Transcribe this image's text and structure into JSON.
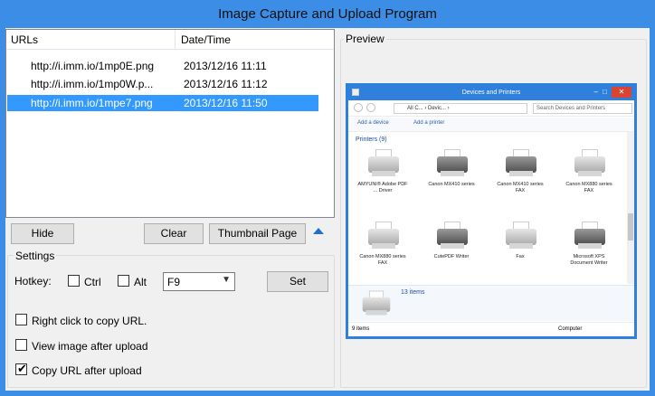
{
  "window": {
    "title": "Image Capture and Upload Program"
  },
  "url_list": {
    "columns": [
      "URLs",
      "Date/Time"
    ],
    "rows": [
      {
        "url": "http://i.imm.io/1mp0E.png",
        "date": "2013/12/16 11:11",
        "selected": false
      },
      {
        "url": "http://i.imm.io/1mp0W.p...",
        "date": "2013/12/16 11:12",
        "selected": false
      },
      {
        "url": "http://i.imm.io/1mpe7.png",
        "date": "2013/12/16 11:50",
        "selected": true
      }
    ]
  },
  "buttons": {
    "hide": "Hide",
    "clear": "Clear",
    "thumbnail_page": "Thumbnail Page",
    "set": "Set"
  },
  "settings": {
    "label": "Settings",
    "hotkey_label": "Hotkey:",
    "ctrl": {
      "label": "Ctrl",
      "checked": false
    },
    "alt": {
      "label": "Alt",
      "checked": false
    },
    "key": "F9",
    "options": [
      {
        "label": "Right click to copy URL.",
        "checked": false
      },
      {
        "label": "View image after upload",
        "checked": false
      },
      {
        "label": "Copy URL after upload",
        "checked": true
      }
    ]
  },
  "preview": {
    "label": "Preview",
    "image": {
      "title": "Devices and Printers",
      "address": "All C... › Devic... ›",
      "search": "Search Devices and Printers",
      "toolbar_add_device": "Add a device",
      "toolbar_add_printer": "Add a printer",
      "group": "Printers (9)",
      "items": [
        {
          "caption": "AMYUNI® Adobe PDF ... Driver",
          "dark": false
        },
        {
          "caption": "Canon MX410 series",
          "dark": true
        },
        {
          "caption": "Canon MX410 series FAX",
          "dark": true
        },
        {
          "caption": "Canon MX880 series FAX",
          "dark": false
        },
        {
          "caption": "Canon MX880 series FAX",
          "dark": false
        },
        {
          "caption": "CutePDF Writer",
          "dark": true
        },
        {
          "caption": "Fax",
          "dark": false
        },
        {
          "caption": "Microsoft XPS Document Writer",
          "dark": true
        }
      ],
      "count": "13 items",
      "status_left": "9 items",
      "status_right": "Computer"
    }
  },
  "colors": {
    "frame": "#3c8de6",
    "selection": "#3399ff",
    "accent_arrow": "#1f6fd0"
  }
}
